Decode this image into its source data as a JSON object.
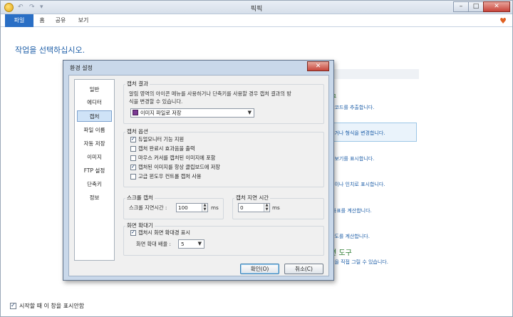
{
  "app": {
    "title": "픽픽"
  },
  "ribbon": {
    "tabs": [
      "파일",
      "홈",
      "공유",
      "보기"
    ]
  },
  "main": {
    "prompt": "작업을 선택하십시오."
  },
  "task_panel": {
    "heading_1": "구",
    "heading_2": "편 도구",
    "lines": [
      "상코드를 추출합니다.",
      "하거나 형식을 변경합니다.",
      "돋보기를 표시합니다.",
      "높이나 인치로 표시합니다.",
      "!좌표를 계산합니다.",
      "각도를 계산합니다.",
      "용을 직접 그릴 수 있습니다."
    ]
  },
  "footer": {
    "startup_label": "시작할 때 이 창을 표시안함",
    "startup_checked": true
  },
  "dialog": {
    "title": "환경 설정",
    "nav": [
      "일반",
      "에디터",
      "캡처",
      "파일 이름",
      "자동 저장",
      "이미지",
      "FTP 설정",
      "단축키",
      "정보"
    ],
    "selected_nav": "캡처",
    "capture_result": {
      "label": "캡처 결과",
      "description_line1": "알림 영역의 아이콘 메뉴를 사용하거나 단축키를 사용할 경우 캡처 결과의 방",
      "description_line2": "식을 변경할 수 있습니다.",
      "selected_option": "이미지 파일로 저장"
    },
    "capture_options": {
      "label": "캡처 옵션",
      "items": [
        {
          "label": "듀얼모니터 기능 지원",
          "checked": true
        },
        {
          "label": "캡처 완료시 효과음을 출력",
          "checked": false
        },
        {
          "label": "마우스 커서를 캡처된 이미지에 포함",
          "checked": false
        },
        {
          "label": "캡처된 이미지를 항상 클립보드에 저장",
          "checked": true
        },
        {
          "label": "고급 윈도우 컨트롤 캡처 사용",
          "checked": false
        }
      ]
    },
    "scroll_capture": {
      "label": "스크롤 캡처",
      "delay_label": "스크롤 지연시간 :",
      "delay_value": "100",
      "unit": "ms"
    },
    "capture_delay": {
      "label": "캡처 지연 시간",
      "value": "0",
      "unit": "ms"
    },
    "zoom": {
      "label": "화면 확대기",
      "show_label": "캡처시 화면 확대경 표시",
      "show_checked": true,
      "ratio_label": "화면 확대 배율 :",
      "ratio_value": "5"
    },
    "buttons": {
      "ok": "확인(O)",
      "cancel": "취소(C)"
    }
  }
}
